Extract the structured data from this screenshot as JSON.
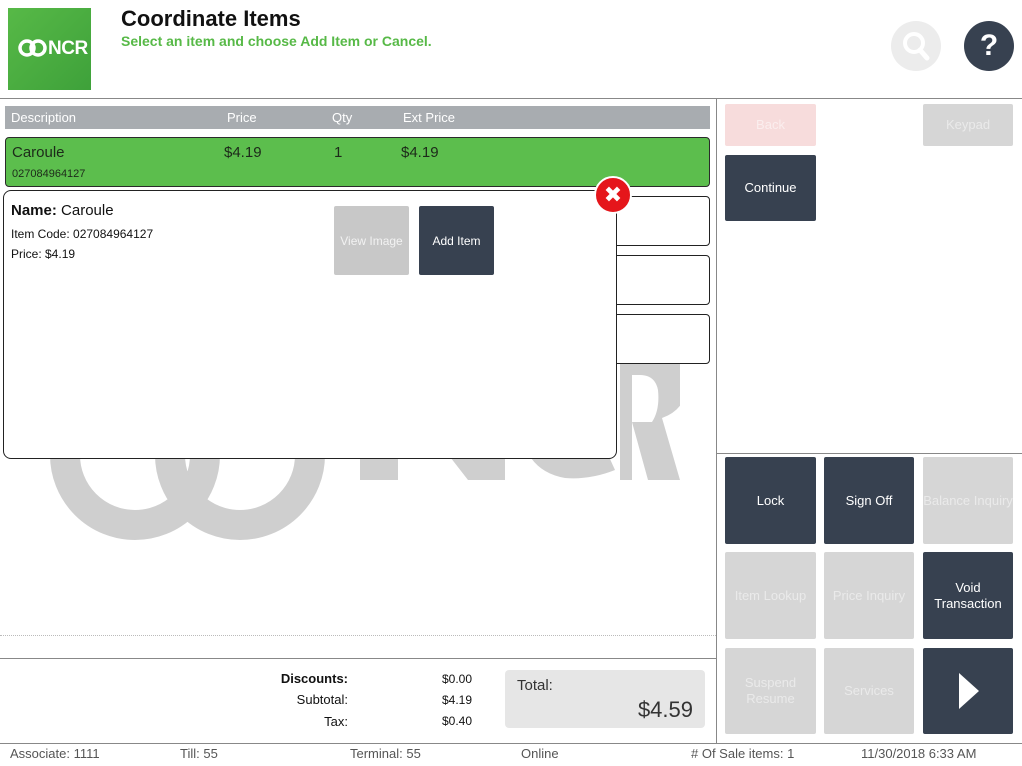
{
  "header": {
    "logo_text": "NCR",
    "title": "Coordinate Items",
    "subtitle": "Select an item and choose Add Item or Cancel.",
    "help_glyph": "?"
  },
  "table": {
    "headers": {
      "description": "Description",
      "price": "Price",
      "qty": "Qty",
      "ext_price": "Ext Price"
    },
    "selected_row": {
      "description": "Caroule",
      "price": "$4.19",
      "qty": "1",
      "ext_price": "$4.19",
      "code": "027084964127"
    }
  },
  "popup": {
    "name_label": "Name:",
    "name_value": "Caroule",
    "item_code": "Item Code: 027084964127",
    "price": "Price: $4.19",
    "view_image_label": "View Image",
    "add_item_label": "Add Item",
    "close_glyph": "✖"
  },
  "right_panel": {
    "back_label": "Back",
    "keypad_label": "Keypad",
    "continue_label": "Continue",
    "lock_label": "Lock",
    "sign_off_label": "Sign Off",
    "balance_inquiry_label": "Balance Inquiry",
    "item_lookup_label": "Item Lookup",
    "price_inquiry_label": "Price Inquiry",
    "void_transaction_label": "Void Transaction",
    "suspend_resume_label": "Suspend Resume",
    "services_label": "Services"
  },
  "totals": {
    "discounts_label": "Discounts:",
    "discounts_value": "$0.00",
    "subtotal_label": "Subtotal:",
    "subtotal_value": "$4.19",
    "tax_label": "Tax:",
    "tax_value": "$0.40",
    "total_label": "Total:",
    "total_value": "$4.59"
  },
  "status_bar": {
    "associate": "Associate: 1111",
    "till": "Till: 55",
    "terminal": "Terminal: 55",
    "online": "Online",
    "sale_items": "# Of Sale items: 1",
    "datetime": "11/30/2018 6:33 AM"
  },
  "colors": {
    "accent_green": "#5cbe4d",
    "dark_button": "#374150",
    "close_red": "#e5161b"
  }
}
